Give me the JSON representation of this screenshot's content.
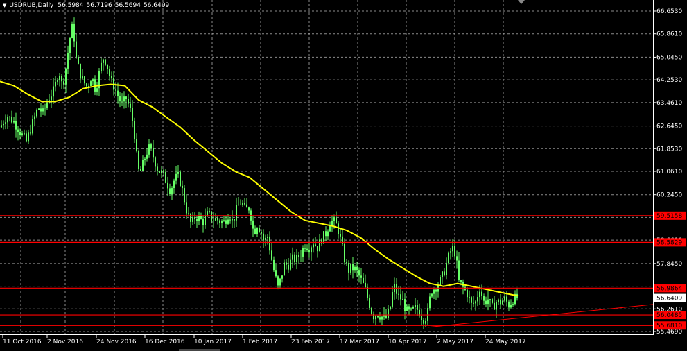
{
  "header": {
    "symbol_label": "USDRUB,Daily",
    "open": "56.5984",
    "high": "56.7196",
    "low": "56.5694",
    "close": "56.6409"
  },
  "colors": {
    "background": "#000000",
    "grid": "#c8c8c8",
    "bull_candle": "#66ff66",
    "moving_average": "#ffff00",
    "level_line": "#ff0000",
    "trendline": "#ff0000",
    "price_tag": "#ffffff",
    "axis_text": "#ffffff"
  },
  "chart_data": {
    "type": "candlestick",
    "symbol": "USDRUB",
    "timeframe": "Daily",
    "grid": true,
    "ylim": [
      55.469,
      66.653
    ],
    "y_ticks": [
      "66.6530",
      "65.8610",
      "65.0450",
      "64.2530",
      "63.4610",
      "62.6450",
      "61.8530",
      "61.0610",
      "60.2450",
      "59.4530",
      "58.6610",
      "57.8450",
      "57.0530",
      "56.2610",
      "55.4690"
    ],
    "x_ticks": [
      "11 Oct 2016",
      "2 Nov 2016",
      "24 Nov 2016",
      "16 Dec 2016",
      "10 Jan 2017",
      "1 Feb 2017",
      "23 Feb 2017",
      "17 Mar 2017",
      "10 Apr 2017",
      "2 May 2017",
      "24 May 2017"
    ],
    "levels": [
      {
        "label": "59.5158"
      },
      {
        "label": "58.5829"
      },
      {
        "label": "56.9864"
      },
      {
        "label": "56.0485"
      },
      {
        "label": "55.6810"
      }
    ],
    "current_price": "56.6409",
    "close_path": [
      [
        0,
        62.6
      ],
      [
        10,
        63.0
      ],
      [
        20,
        62.8
      ],
      [
        30,
        62.4
      ],
      [
        38,
        62.1
      ],
      [
        45,
        62.6
      ],
      [
        55,
        63.3
      ],
      [
        62,
        63.1
      ],
      [
        70,
        63.6
      ],
      [
        78,
        63.9
      ],
      [
        85,
        64.6
      ],
      [
        90,
        64.0
      ],
      [
        96,
        64.8
      ],
      [
        100,
        65.6
      ],
      [
        105,
        66.2
      ],
      [
        110,
        65.0
      ],
      [
        115,
        64.5
      ],
      [
        120,
        64.2
      ],
      [
        126,
        64.0
      ],
      [
        132,
        64.4
      ],
      [
        138,
        63.9
      ],
      [
        144,
        64.6
      ],
      [
        150,
        65.1
      ],
      [
        155,
        64.7
      ],
      [
        160,
        64.2
      ],
      [
        165,
        64.0
      ],
      [
        170,
        63.7
      ],
      [
        176,
        63.4
      ],
      [
        182,
        63.6
      ],
      [
        188,
        63.2
      ],
      [
        193,
        62.6
      ],
      [
        197,
        61.6
      ],
      [
        201,
        60.9
      ],
      [
        206,
        61.3
      ],
      [
        211,
        61.7
      ],
      [
        216,
        61.9
      ],
      [
        222,
        61.5
      ],
      [
        228,
        61.1
      ],
      [
        234,
        61.0
      ],
      [
        240,
        60.7
      ],
      [
        246,
        60.4
      ],
      [
        252,
        60.8
      ],
      [
        258,
        60.9
      ],
      [
        264,
        60.3
      ],
      [
        270,
        59.6
      ],
      [
        276,
        59.2
      ],
      [
        282,
        59.5
      ],
      [
        288,
        59.4
      ],
      [
        294,
        59.3
      ],
      [
        300,
        59.6
      ],
      [
        306,
        59.4
      ],
      [
        312,
        59.4
      ],
      [
        318,
        59.3
      ],
      [
        324,
        59.3
      ],
      [
        330,
        59.6
      ],
      [
        336,
        59.3
      ],
      [
        342,
        59.8
      ],
      [
        348,
        60.0
      ],
      [
        354,
        59.7
      ],
      [
        360,
        59.8
      ],
      [
        366,
        58.9
      ],
      [
        371,
        59.2
      ],
      [
        376,
        59.0
      ],
      [
        381,
        58.6
      ],
      [
        386,
        58.8
      ],
      [
        391,
        58.1
      ],
      [
        396,
        57.5
      ],
      [
        401,
        57.0
      ],
      [
        405,
        57.3
      ],
      [
        410,
        57.8
      ],
      [
        416,
        57.8
      ],
      [
        422,
        58.0
      ],
      [
        428,
        58.0
      ],
      [
        434,
        58.2
      ],
      [
        440,
        58.5
      ],
      [
        446,
        58.4
      ],
      [
        452,
        58.6
      ],
      [
        458,
        58.4
      ],
      [
        464,
        58.7
      ],
      [
        470,
        58.9
      ],
      [
        476,
        59.3
      ],
      [
        482,
        59.3
      ],
      [
        487,
        59.1
      ],
      [
        492,
        58.6
      ],
      [
        497,
        58.0
      ],
      [
        502,
        57.6
      ],
      [
        508,
        57.7
      ],
      [
        514,
        57.6
      ],
      [
        520,
        57.3
      ],
      [
        526,
        57.0
      ],
      [
        532,
        56.5
      ],
      [
        538,
        56.0
      ],
      [
        544,
        56.1
      ],
      [
        550,
        56.0
      ],
      [
        556,
        55.9
      ],
      [
        562,
        56.2
      ],
      [
        568,
        57.1
      ],
      [
        574,
        56.7
      ],
      [
        580,
        56.6
      ],
      [
        586,
        56.2
      ],
      [
        592,
        56.1
      ],
      [
        598,
        56.3
      ],
      [
        604,
        56.2
      ],
      [
        610,
        55.9
      ],
      [
        616,
        56.0
      ],
      [
        622,
        56.9
      ],
      [
        628,
        57.0
      ],
      [
        634,
        57.2
      ],
      [
        640,
        57.5
      ],
      [
        646,
        58.0
      ],
      [
        652,
        58.4
      ],
      [
        657,
        58.2
      ],
      [
        662,
        57.2
      ],
      [
        668,
        57.0
      ],
      [
        674,
        56.8
      ],
      [
        680,
        56.4
      ],
      [
        686,
        56.5
      ],
      [
        692,
        57.0
      ],
      [
        698,
        56.5
      ],
      [
        704,
        56.6
      ],
      [
        710,
        56.3
      ],
      [
        716,
        56.5
      ],
      [
        722,
        56.5
      ],
      [
        728,
        56.6
      ],
      [
        734,
        56.4
      ],
      [
        740,
        56.6
      ],
      [
        746,
        56.64
      ]
    ],
    "ma_path": [
      [
        0,
        64.2
      ],
      [
        20,
        64.05
      ],
      [
        40,
        63.75
      ],
      [
        60,
        63.5
      ],
      [
        80,
        63.5
      ],
      [
        100,
        63.65
      ],
      [
        120,
        63.95
      ],
      [
        140,
        64.05
      ],
      [
        160,
        64.1
      ],
      [
        180,
        64.05
      ],
      [
        200,
        63.55
      ],
      [
        220,
        63.3
      ],
      [
        240,
        62.95
      ],
      [
        260,
        62.6
      ],
      [
        280,
        62.15
      ],
      [
        300,
        61.75
      ],
      [
        320,
        61.35
      ],
      [
        340,
        61.05
      ],
      [
        360,
        60.85
      ],
      [
        380,
        60.45
      ],
      [
        400,
        60.05
      ],
      [
        420,
        59.65
      ],
      [
        440,
        59.35
      ],
      [
        460,
        59.25
      ],
      [
        480,
        59.15
      ],
      [
        500,
        59.0
      ],
      [
        520,
        58.75
      ],
      [
        540,
        58.35
      ],
      [
        560,
        58.0
      ],
      [
        580,
        57.7
      ],
      [
        600,
        57.4
      ],
      [
        620,
        57.15
      ],
      [
        640,
        57.05
      ],
      [
        660,
        57.15
      ],
      [
        680,
        57.05
      ],
      [
        700,
        56.95
      ],
      [
        720,
        56.85
      ],
      [
        740,
        56.75
      ],
      [
        747,
        56.72
      ]
    ]
  }
}
